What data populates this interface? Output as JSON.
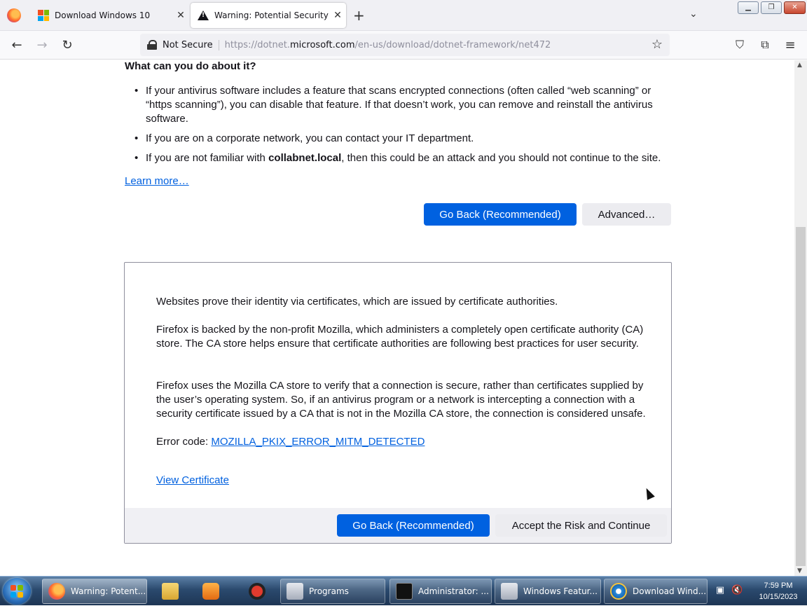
{
  "tabs": [
    {
      "label": "Download Windows 10",
      "icon": "windows-logo-icon",
      "active": false
    },
    {
      "label": "Warning: Potential Security Risk Ahead",
      "icon": "warning-icon",
      "active": true
    }
  ],
  "nav": {
    "security_label": "Not Secure",
    "url_prefix": "https://dotnet.",
    "url_domain": "microsoft.com",
    "url_path": "/en-us/download/dotnet-framework/net472"
  },
  "page": {
    "heading": "What can you do about it?",
    "bullets": [
      "If your antivirus software includes a feature that scans encrypted connections (often called “web scanning” or “https scanning”), you can disable that feature. If that doesn’t work, you can remove and reinstall the antivirus software.",
      "If you are on a corporate network, you can contact your IT department."
    ],
    "bullet3_prefix": "If you are not familiar with ",
    "bullet3_domain": "collabnet.local",
    "bullet3_suffix": ", then this could be an attack and you should not continue to the site.",
    "learn_more": "Learn more…",
    "go_back": "Go Back (Recommended)",
    "advanced": "Advanced…"
  },
  "advanced_panel": {
    "p1": "Websites prove their identity via certificates, which are issued by certificate authorities.",
    "p2": "Firefox is backed by the non-profit Mozilla, which administers a completely open certificate authority (CA) store. The CA store helps ensure that certificate authorities are following best practices for user security.",
    "p3": "Firefox uses the Mozilla CA store to verify that a connection is secure, rather than certificates supplied by the user’s operating system. So, if an antivirus program or a network is intercepting a connection with a security certificate issued by a CA that is not in the Mozilla CA store, the connection is considered unsafe.",
    "error_label": "Error code: ",
    "error_code": "MOZILLA_PKIX_ERROR_MITM_DETECTED",
    "view_certificate": "View Certificate",
    "go_back": "Go Back (Recommended)",
    "accept": "Accept the Risk and Continue"
  },
  "taskbar": {
    "items": [
      {
        "label": "Warning: Potent...",
        "icon": "firefox-icon"
      },
      {
        "label": "Programs",
        "icon": "programs-icon"
      },
      {
        "label": "Administrator: ...",
        "icon": "cmd-icon"
      },
      {
        "label": "Windows Featur...",
        "icon": "windows-features-icon"
      },
      {
        "label": "Download Wind...",
        "icon": "ie-icon"
      }
    ],
    "time": "7:59 PM",
    "date": "10/15/2023"
  },
  "colors": {
    "primary_button": "#0061e0",
    "link": "#0060df",
    "taskbar": "#2b4a6e"
  }
}
